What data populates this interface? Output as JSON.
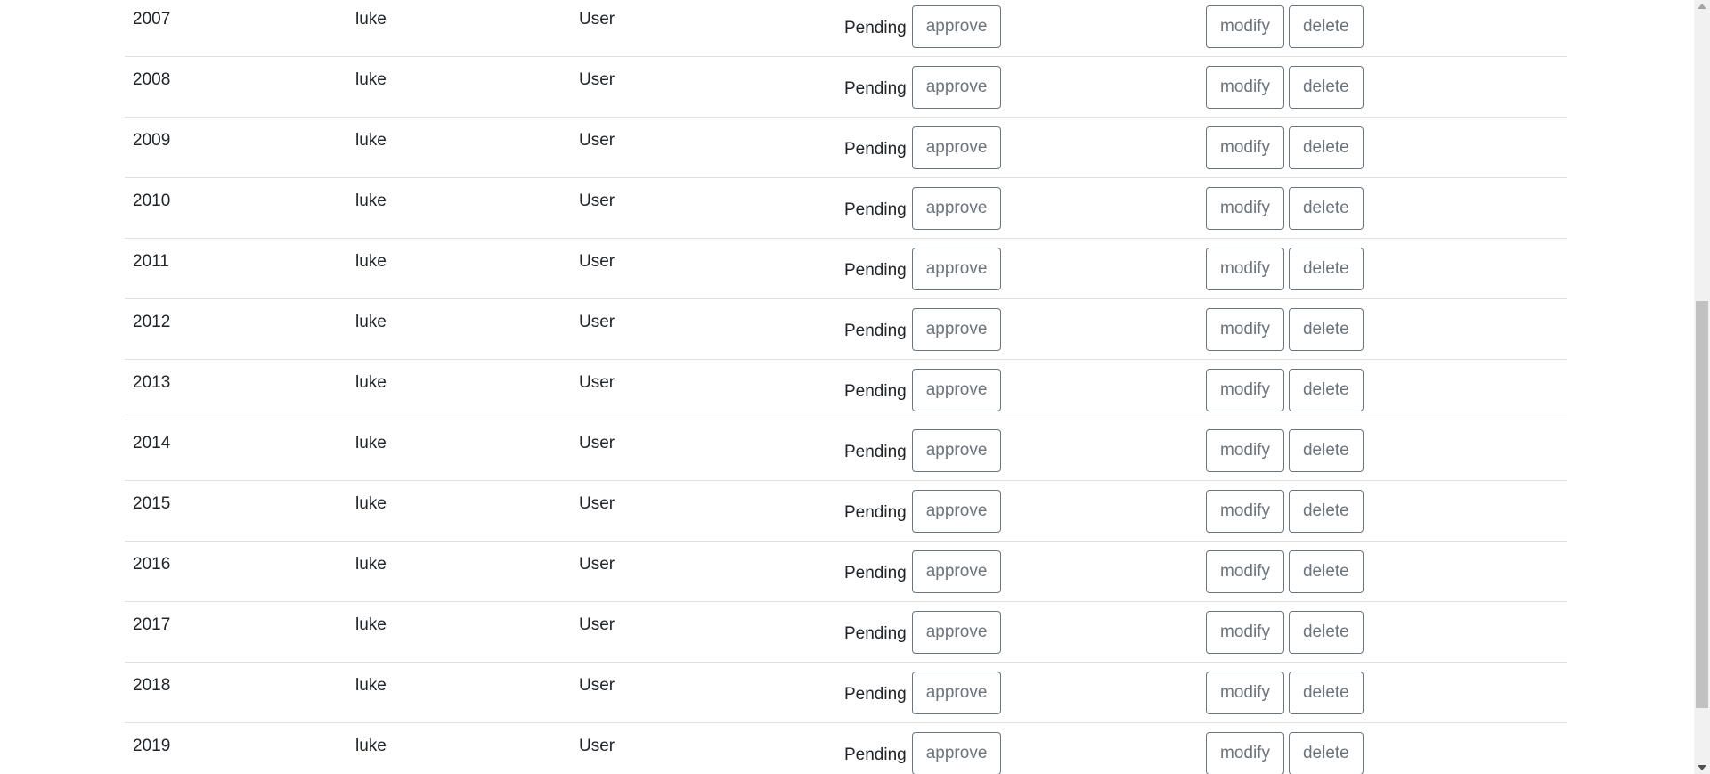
{
  "table": {
    "rows": [
      {
        "id": "2007",
        "name": "luke",
        "role": "User",
        "status": "Pending"
      },
      {
        "id": "2008",
        "name": "luke",
        "role": "User",
        "status": "Pending"
      },
      {
        "id": "2009",
        "name": "luke",
        "role": "User",
        "status": "Pending"
      },
      {
        "id": "2010",
        "name": "luke",
        "role": "User",
        "status": "Pending"
      },
      {
        "id": "2011",
        "name": "luke",
        "role": "User",
        "status": "Pending"
      },
      {
        "id": "2012",
        "name": "luke",
        "role": "User",
        "status": "Pending"
      },
      {
        "id": "2013",
        "name": "luke",
        "role": "User",
        "status": "Pending"
      },
      {
        "id": "2014",
        "name": "luke",
        "role": "User",
        "status": "Pending"
      },
      {
        "id": "2015",
        "name": "luke",
        "role": "User",
        "status": "Pending"
      },
      {
        "id": "2016",
        "name": "luke",
        "role": "User",
        "status": "Pending"
      },
      {
        "id": "2017",
        "name": "luke",
        "role": "User",
        "status": "Pending"
      },
      {
        "id": "2018",
        "name": "luke",
        "role": "User",
        "status": "Pending"
      },
      {
        "id": "2019",
        "name": "luke",
        "role": "User",
        "status": "Pending"
      }
    ],
    "actions": {
      "approve_label": "approve",
      "modify_label": "modify",
      "delete_label": "delete"
    }
  },
  "colors": {
    "button_outline": "#6c757d",
    "row_divider": "#dee2e6",
    "text": "#212529"
  },
  "icons": {
    "scroll_up": "scroll-up-arrow-icon",
    "scroll_down": "scroll-down-arrow-icon"
  }
}
